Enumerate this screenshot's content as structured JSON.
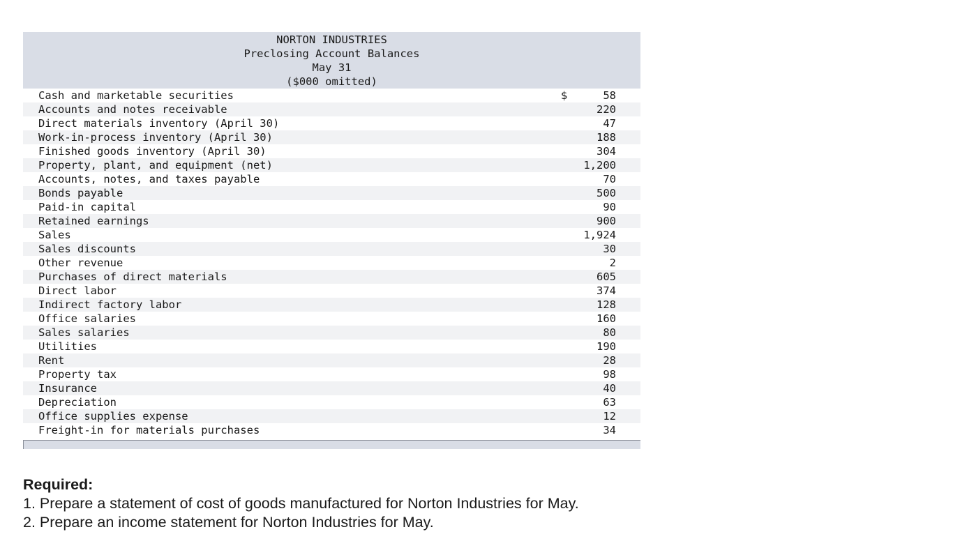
{
  "header": {
    "company": "NORTON INDUSTRIES",
    "title": "Preclosing Account Balances",
    "date": "May 31",
    "note": "($000 omitted)"
  },
  "currency_symbol": "$",
  "rows": [
    {
      "label": "Cash and marketable securities",
      "value": "58"
    },
    {
      "label": "Accounts and notes receivable",
      "value": "220"
    },
    {
      "label": "Direct materials inventory (April 30)",
      "value": "47"
    },
    {
      "label": "Work-in-process inventory (April 30)",
      "value": "188"
    },
    {
      "label": "Finished goods inventory (April 30)",
      "value": "304"
    },
    {
      "label": "Property, plant, and equipment (net)",
      "value": "1,200"
    },
    {
      "label": "Accounts, notes, and taxes payable",
      "value": "70"
    },
    {
      "label": "Bonds payable",
      "value": "500"
    },
    {
      "label": "Paid-in capital",
      "value": "90"
    },
    {
      "label": "Retained earnings",
      "value": "900"
    },
    {
      "label": "Sales",
      "value": "1,924"
    },
    {
      "label": "Sales discounts",
      "value": "30"
    },
    {
      "label": "Other revenue",
      "value": "2"
    },
    {
      "label": "Purchases of direct materials",
      "value": "605"
    },
    {
      "label": "Direct labor",
      "value": "374"
    },
    {
      "label": "Indirect factory labor",
      "value": "128"
    },
    {
      "label": "Office salaries",
      "value": "160"
    },
    {
      "label": "Sales salaries",
      "value": "80"
    },
    {
      "label": "Utilities",
      "value": "190"
    },
    {
      "label": "Rent",
      "value": "28"
    },
    {
      "label": "Property tax",
      "value": "98"
    },
    {
      "label": "Insurance",
      "value": "40"
    },
    {
      "label": "Depreciation",
      "value": "63"
    },
    {
      "label": "Office supplies expense",
      "value": "12"
    },
    {
      "label": "Freight-in for materials purchases",
      "value": "34"
    }
  ],
  "required": {
    "title": "Required:",
    "items": [
      "1. Prepare a statement of cost of goods manufactured for Norton Industries for May.",
      "2. Prepare an income statement for Norton Industries for May."
    ]
  }
}
